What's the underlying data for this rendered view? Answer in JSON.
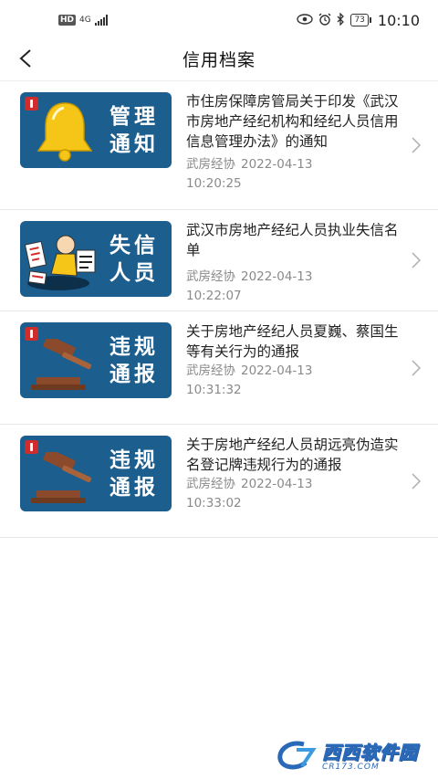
{
  "status_bar": {
    "hd": "HD",
    "network": "4G",
    "battery": "73",
    "time": "10:10"
  },
  "header": {
    "title": "信用档案"
  },
  "items": [
    {
      "thumb_line1": "管理",
      "thumb_line2": "通知",
      "title": "市住房保障房管局关于印发《武汉市房地产经纪机构和经纪人员信用信息管理办法》的通知",
      "source": "武房经协",
      "date": "2022-04-13",
      "time": "10:20:25"
    },
    {
      "thumb_line1": "失信",
      "thumb_line2": "人员",
      "title": "武汉市房地产经纪人员执业失信名单",
      "source": "武房经协",
      "date": "2022-04-13",
      "time": "10:22:07"
    },
    {
      "thumb_line1": "违规",
      "thumb_line2": "通报",
      "title": "关于房地产经纪人员夏巍、蔡国生等有关行为的通报",
      "source": "武房经协",
      "date": "2022-04-13",
      "time": "10:31:32"
    },
    {
      "thumb_line1": "违规",
      "thumb_line2": "通报",
      "title": "关于房地产经纪人员胡远亮伪造实名登记牌违规行为的通报",
      "source": "武房经协",
      "date": "2022-04-13",
      "time": "10:33:02"
    }
  ],
  "watermark": {
    "brand": "西西软件园",
    "sub": "CR173.COM"
  },
  "colors": {
    "thumb_bg": "#1c5e8d",
    "badge_red": "#d12c2c",
    "meta_gray": "#8a8a8a",
    "bell_yellow": "#f5c518",
    "gavel_brown": "#8b4a2b"
  }
}
